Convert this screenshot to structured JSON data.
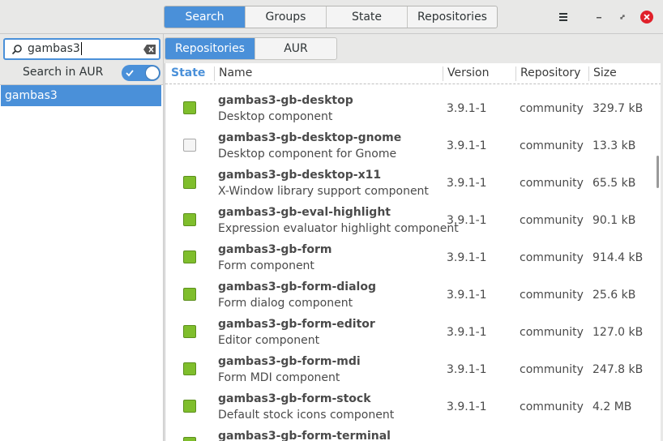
{
  "header": {
    "tabs": [
      {
        "label": "Search",
        "active": true
      },
      {
        "label": "Groups",
        "active": false
      },
      {
        "label": "State",
        "active": false
      },
      {
        "label": "Repositories",
        "active": false
      }
    ],
    "menu_icon": "hamburger-menu-icon",
    "minimize_icon": "minimize-icon",
    "restore_icon": "restore-icon",
    "close_icon": "close-icon"
  },
  "search": {
    "value": "gambas3",
    "search_icon": "search-icon",
    "clear_icon": "clear-icon"
  },
  "aur_toggle": {
    "label": "Search in AUR",
    "enabled": true
  },
  "search_history": [
    {
      "label": "gambas3",
      "selected": true
    }
  ],
  "sub_tabs": [
    {
      "label": "Repositories",
      "active": true
    },
    {
      "label": "AUR",
      "active": false
    }
  ],
  "table": {
    "headers": {
      "state": "State",
      "name": "Name",
      "version": "Version",
      "repository": "Repository",
      "size": "Size"
    },
    "rows": [
      {
        "name": "gambas3-gb-desktop",
        "desc": "Desktop component",
        "version": "3.9.1-1",
        "repo": "community",
        "size": "329.7 kB",
        "installed": true
      },
      {
        "name": "gambas3-gb-desktop-gnome",
        "desc": "Desktop component for Gnome",
        "version": "3.9.1-1",
        "repo": "community",
        "size": "13.3 kB",
        "installed": false
      },
      {
        "name": "gambas3-gb-desktop-x11",
        "desc": "X-Window library support component",
        "version": "3.9.1-1",
        "repo": "community",
        "size": "65.5 kB",
        "installed": true
      },
      {
        "name": "gambas3-gb-eval-highlight",
        "desc": "Expression evaluator highlight component",
        "version": "3.9.1-1",
        "repo": "community",
        "size": "90.1 kB",
        "installed": true
      },
      {
        "name": "gambas3-gb-form",
        "desc": "Form component",
        "version": "3.9.1-1",
        "repo": "community",
        "size": "914.4 kB",
        "installed": true
      },
      {
        "name": "gambas3-gb-form-dialog",
        "desc": "Form dialog component",
        "version": "3.9.1-1",
        "repo": "community",
        "size": "25.6 kB",
        "installed": true
      },
      {
        "name": "gambas3-gb-form-editor",
        "desc": "Editor component",
        "version": "3.9.1-1",
        "repo": "community",
        "size": "127.0 kB",
        "installed": true
      },
      {
        "name": "gambas3-gb-form-mdi",
        "desc": "Form MDI component",
        "version": "3.9.1-1",
        "repo": "community",
        "size": "247.8 kB",
        "installed": true
      },
      {
        "name": "gambas3-gb-form-stock",
        "desc": "Default stock icons component",
        "version": "3.9.1-1",
        "repo": "community",
        "size": "4.2 MB",
        "installed": true
      },
      {
        "name": "gambas3-gb-form-terminal",
        "desc": "",
        "version": "",
        "repo": "",
        "size": "",
        "installed": true
      }
    ]
  },
  "colors": {
    "accent": "#4a90d9",
    "installed": "#7fbe2c",
    "close": "#e0202a"
  }
}
